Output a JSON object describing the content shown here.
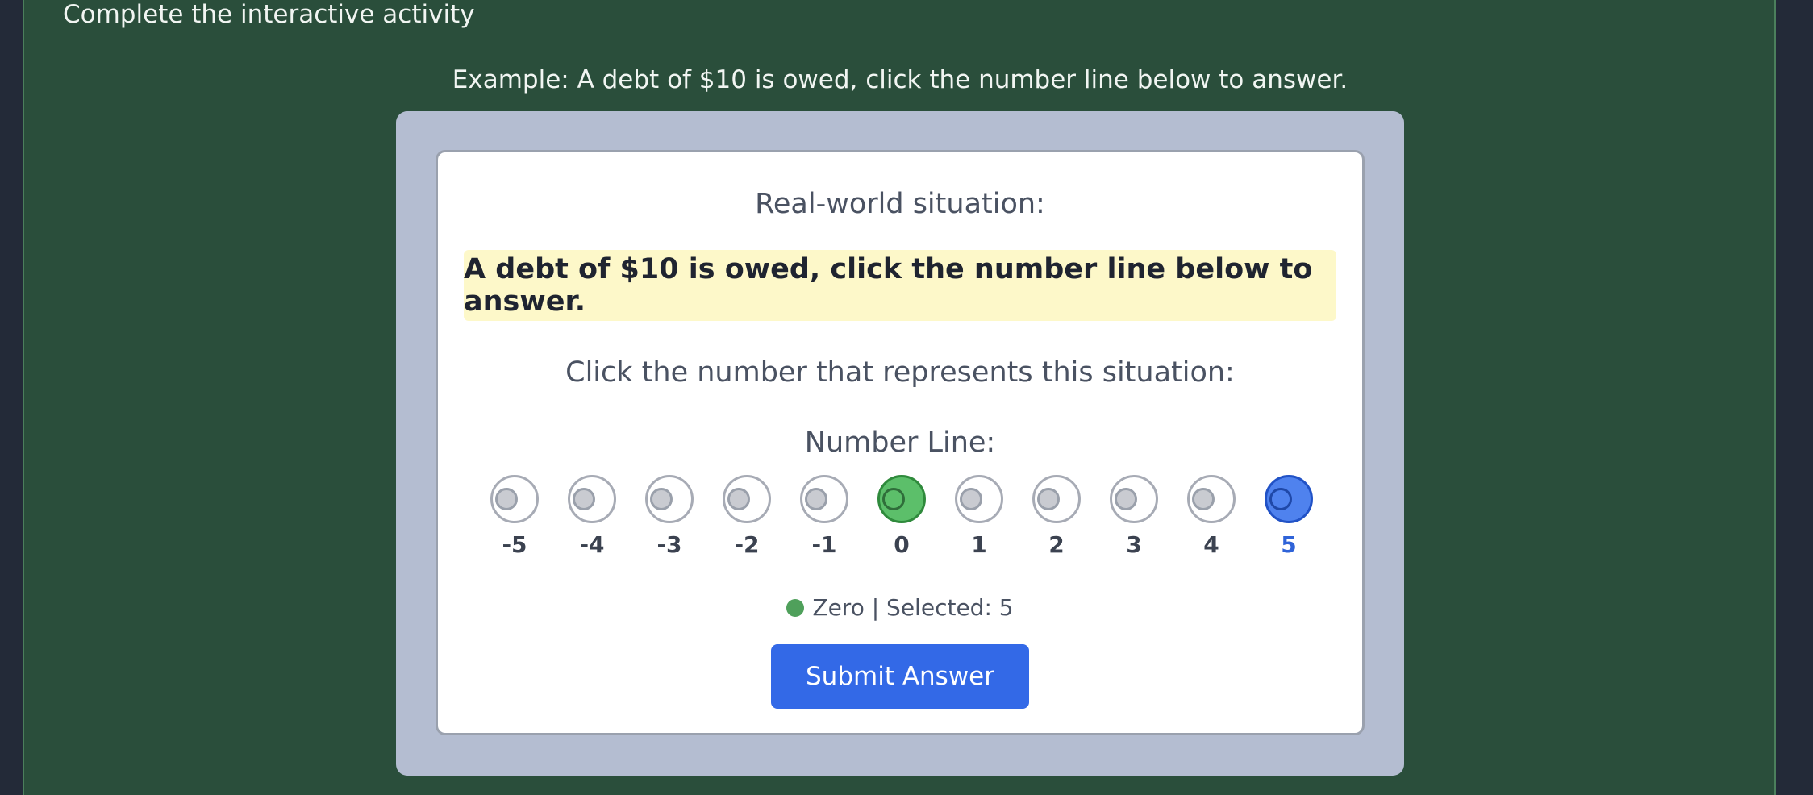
{
  "header": {
    "instructions": "Complete the interactive activity",
    "example": "Example: A debt of $10 is owed, click the number line below to answer."
  },
  "card": {
    "situation_label": "Real-world situation:",
    "situation_text": "A debt of $10 is owed, click the number line below to answer.",
    "prompt": "Click the number that represents this situation:",
    "number_line_label": "Number Line:",
    "numbers": [
      "-5",
      "-4",
      "-3",
      "-2",
      "-1",
      "0",
      "1",
      "2",
      "3",
      "4",
      "5"
    ],
    "zero_value": "0",
    "selected_value": "5",
    "legend_text": "Zero | Selected: 5",
    "submit_label": "Submit Answer"
  },
  "colors": {
    "page_bg": "#232a38",
    "panel_bg": "#2a4e3b",
    "outer_card": "#b4bdd1",
    "highlight": "#fdf8c9",
    "zero_green": "#5cbf6a",
    "selected_blue": "#4f82ee",
    "button_blue": "#3369e7"
  }
}
